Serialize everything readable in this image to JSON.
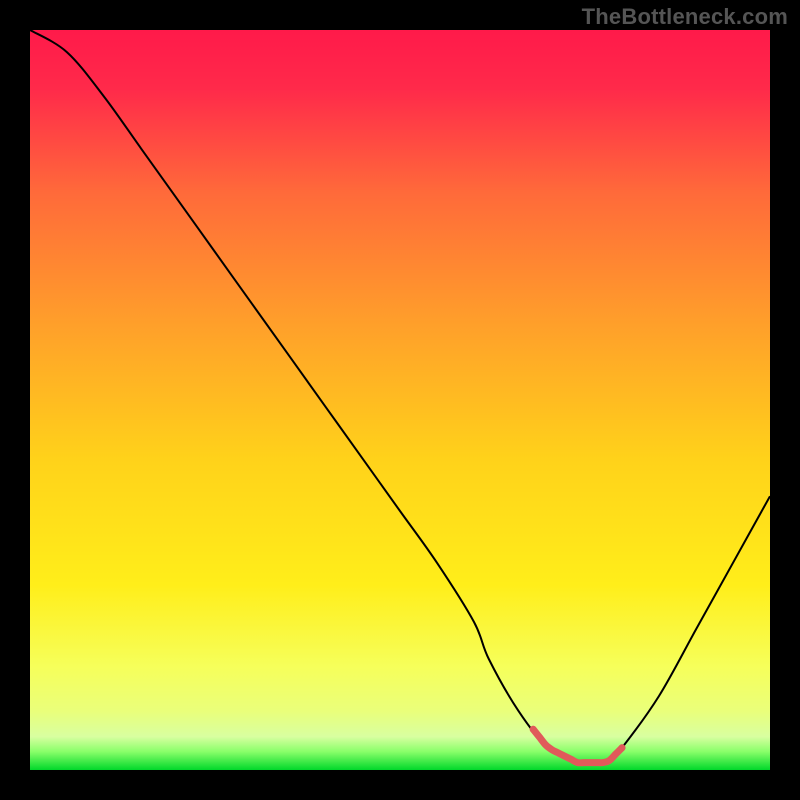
{
  "watermark": "TheBottleneck.com",
  "colors": {
    "top": "#ff1a3a",
    "mid1": "#ff8a2a",
    "mid2": "#ffe81a",
    "mid3": "#f4ff60",
    "bottom": "#00e03a",
    "curve": "#000000",
    "highlight": "#e05a5a",
    "frame": "#000000"
  },
  "chart_data": {
    "type": "line",
    "title": "",
    "xlabel": "",
    "ylabel": "",
    "xlim": [
      0,
      100
    ],
    "ylim": [
      0,
      100
    ],
    "x": [
      0,
      5,
      10,
      15,
      20,
      25,
      30,
      35,
      40,
      45,
      50,
      55,
      60,
      62,
      66,
      70,
      74,
      78,
      80,
      85,
      90,
      95,
      100
    ],
    "values": [
      100,
      97,
      91,
      84,
      77,
      70,
      63,
      56,
      49,
      42,
      35,
      28,
      20,
      15,
      8,
      3,
      1,
      1,
      3,
      10,
      19,
      28,
      37
    ],
    "highlight_range_x": [
      68,
      80
    ],
    "grid": false,
    "legend": false
  }
}
